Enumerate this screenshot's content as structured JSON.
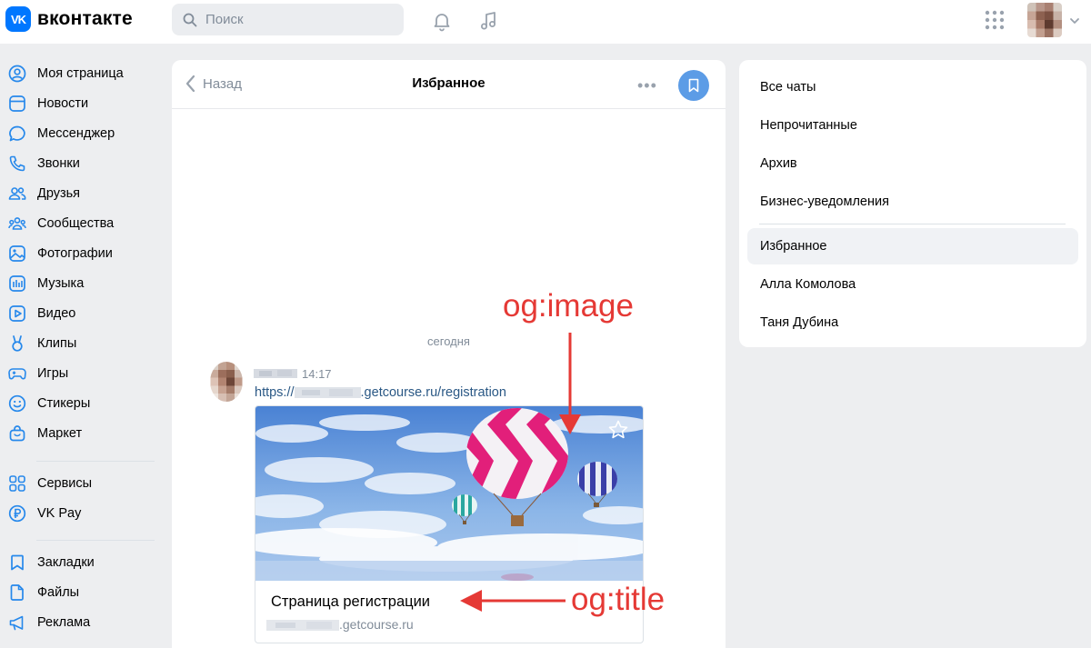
{
  "header": {
    "logo_mark": "VK",
    "logo_text": "вконтакте",
    "search_placeholder": "Поиск"
  },
  "sidebar": {
    "items": [
      {
        "label": "Моя страница",
        "icon": "user-circle-icon"
      },
      {
        "label": "Новости",
        "icon": "news-icon"
      },
      {
        "label": "Мессенджер",
        "icon": "message-icon"
      },
      {
        "label": "Звонки",
        "icon": "phone-icon"
      },
      {
        "label": "Друзья",
        "icon": "friends-icon"
      },
      {
        "label": "Сообщества",
        "icon": "communities-icon"
      },
      {
        "label": "Фотографии",
        "icon": "photo-icon"
      },
      {
        "label": "Музыка",
        "icon": "music-icon"
      },
      {
        "label": "Видео",
        "icon": "video-icon"
      },
      {
        "label": "Клипы",
        "icon": "clips-icon"
      },
      {
        "label": "Игры",
        "icon": "gamepad-icon"
      },
      {
        "label": "Стикеры",
        "icon": "sticker-icon"
      },
      {
        "label": "Маркет",
        "icon": "market-icon"
      },
      {
        "label": "Сервисы",
        "icon": "services-icon"
      },
      {
        "label": "VK Pay",
        "icon": "vkpay-icon"
      },
      {
        "label": "Закладки",
        "icon": "bookmark-icon"
      },
      {
        "label": "Файлы",
        "icon": "file-icon"
      },
      {
        "label": "Реклама",
        "icon": "megaphone-icon"
      }
    ]
  },
  "chat": {
    "back_label": "Назад",
    "title": "Избранное",
    "more": "•••",
    "day_label": "сегодня",
    "message": {
      "time": "14:17",
      "link_prefix": "https://",
      "link_suffix": ".getcourse.ru/registration",
      "card_title": "Страница регистрации",
      "card_domain_suffix": ".getcourse.ru"
    }
  },
  "right_panel": {
    "items": [
      {
        "label": "Все чаты"
      },
      {
        "label": "Непрочитанные"
      },
      {
        "label": "Архив"
      },
      {
        "label": "Бизнес-уведомления"
      },
      {
        "label": "Избранное"
      },
      {
        "label": "Алла Комолова"
      },
      {
        "label": "Таня Дубина"
      }
    ],
    "active": "Избранное"
  },
  "annotations": {
    "image_label": "og:image",
    "title_label": "og:title",
    "color": "#e53935"
  },
  "colors": {
    "accent": "#0077ff",
    "link": "#2a5885",
    "secondary_text": "#818c99",
    "bookmark_button": "#5c9ce6"
  }
}
